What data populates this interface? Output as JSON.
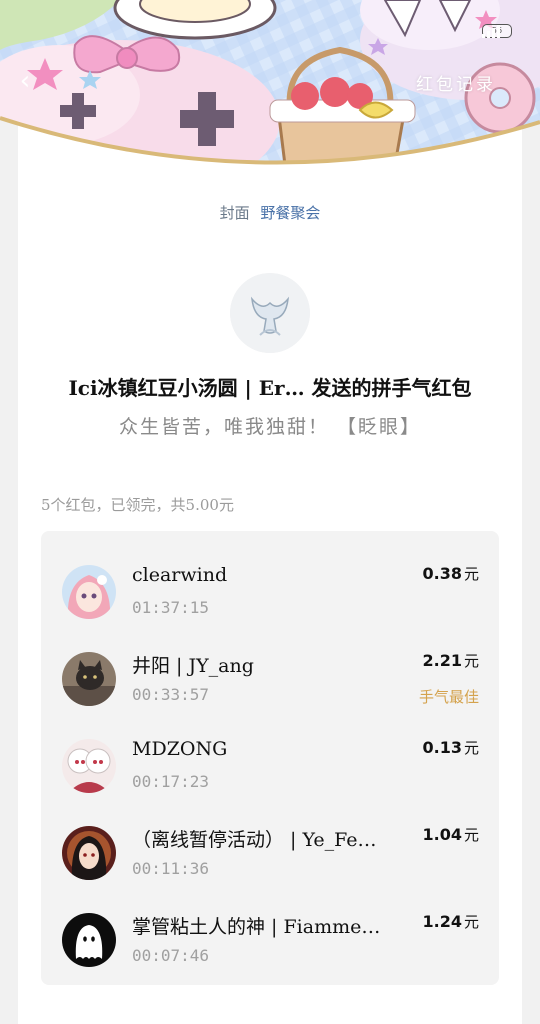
{
  "header": {
    "title": "红包记录",
    "status": {
      "battery": "56"
    }
  },
  "cover": {
    "label": "封面",
    "value": "野餐聚会"
  },
  "sender": {
    "line": "Ici冰镇红豆小汤圆 | Er… 发送的拼手气红包",
    "greeting": "众生皆苦，唯我独甜！ 【眨眼】"
  },
  "summary": "5个红包，已领完，共5.00元",
  "records": [
    {
      "name": "clearwind",
      "time": "01:37:15",
      "amount": "0.38",
      "unit": "元",
      "best": ""
    },
    {
      "name": "井阳 | JY_ang",
      "time": "00:33:57",
      "amount": "2.21",
      "unit": "元",
      "best": "手气最佳"
    },
    {
      "name": "MDZONG",
      "time": "00:17:23",
      "amount": "0.13",
      "unit": "元",
      "best": ""
    },
    {
      "name": "（离线暂停活动） | Ye_Fe…",
      "time": "00:11:36",
      "amount": "1.04",
      "unit": "元",
      "best": ""
    },
    {
      "name": "掌管粘土人的神 | Fiamme…",
      "time": "00:07:46",
      "amount": "1.24",
      "unit": "元",
      "best": ""
    }
  ],
  "colors": {
    "accent_blue": "#4a72a8",
    "best_gold": "#d4a24c",
    "page_bg": "#f1f1f1"
  }
}
